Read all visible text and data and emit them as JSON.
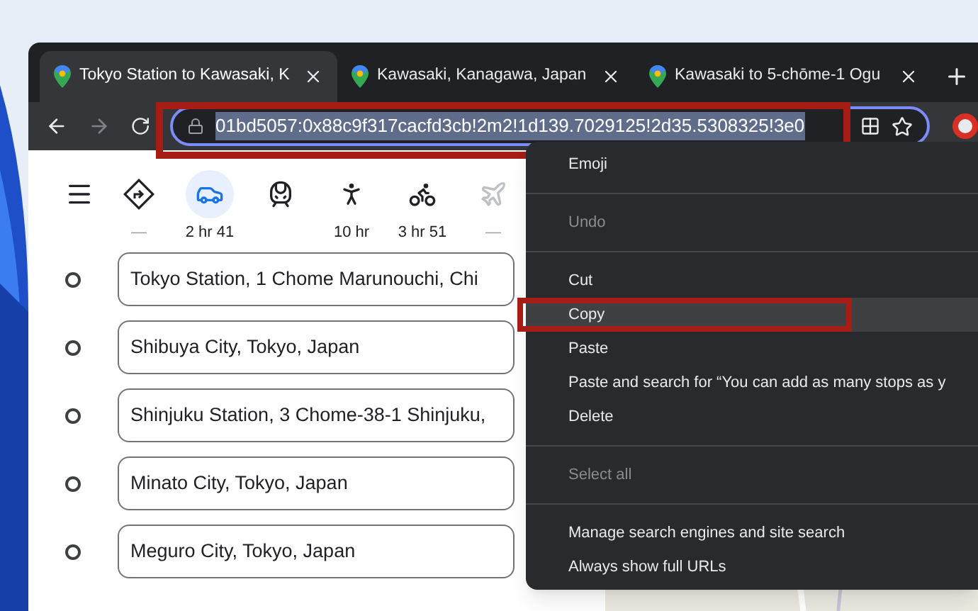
{
  "tabs": [
    {
      "title": "Tokyo Station to Kawasaki, K",
      "selected": true
    },
    {
      "title": "Kawasaki, Kanagawa, Japan",
      "selected": false
    },
    {
      "title": "Kawasaki to 5-chōme-1 Ogu",
      "selected": false
    }
  ],
  "address_bar": {
    "value": "01bd5057:0x88c9f317cacfd3cb!2m2!1d139.7029125!2d35.5308325!3e0",
    "highlighted": true
  },
  "travel_modes": [
    {
      "kind": "best",
      "label": "—",
      "selected": false,
      "disabled": false
    },
    {
      "kind": "car",
      "label": "2 hr 41",
      "selected": true,
      "disabled": false
    },
    {
      "kind": "train",
      "selected": false,
      "disabled": false
    },
    {
      "kind": "walk",
      "label": "10 hr",
      "selected": false,
      "disabled": false
    },
    {
      "kind": "bike",
      "label": "3 hr 51",
      "selected": false,
      "disabled": false
    },
    {
      "kind": "plane",
      "label": "—",
      "selected": false,
      "disabled": true
    }
  ],
  "stops": [
    {
      "value": "Tokyo Station, 1 Chome Marunouchi, Chi"
    },
    {
      "value": "Shibuya City, Tokyo, Japan"
    },
    {
      "value": "Shinjuku Station, 3 Chome-38-1 Shinjuku,"
    },
    {
      "value": "Minato City, Tokyo, Japan"
    },
    {
      "value": "Meguro City, Tokyo, Japan"
    }
  ],
  "context_menu": [
    {
      "kind": "item",
      "label": "Emoji",
      "disabled": false,
      "highlighted": false
    },
    {
      "kind": "separator"
    },
    {
      "kind": "item",
      "label": "Undo",
      "disabled": true,
      "highlighted": false
    },
    {
      "kind": "separator"
    },
    {
      "kind": "item",
      "label": "Cut",
      "disabled": false,
      "highlighted": false
    },
    {
      "kind": "item",
      "label": "Copy",
      "disabled": false,
      "highlighted": true
    },
    {
      "kind": "item",
      "label": "Paste",
      "disabled": false,
      "highlighted": false
    },
    {
      "kind": "item",
      "label": "Paste and search for “You can add as many stops as y",
      "disabled": false,
      "highlighted": false
    },
    {
      "kind": "item",
      "label": "Delete",
      "disabled": false,
      "highlighted": false
    },
    {
      "kind": "separator"
    },
    {
      "kind": "item",
      "label": "Select all",
      "disabled": true,
      "highlighted": false
    },
    {
      "kind": "separator"
    },
    {
      "kind": "item",
      "label": "Manage search engines and site search",
      "disabled": false,
      "highlighted": false
    },
    {
      "kind": "item",
      "label": "Always show full URLs",
      "disabled": false,
      "highlighted": false
    }
  ]
}
